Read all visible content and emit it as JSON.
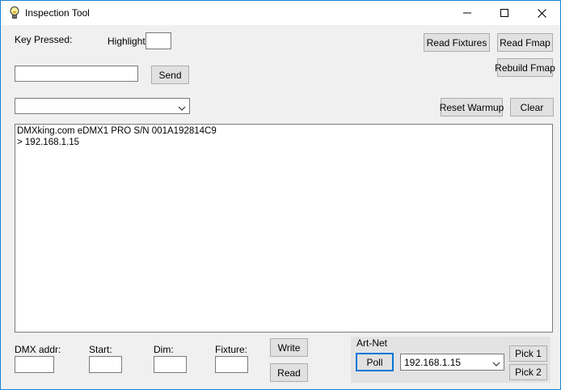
{
  "window": {
    "title": "Inspection Tool",
    "app_icon": "lightbulb-icon",
    "controls": [
      "minimize-icon",
      "maximize-icon",
      "close-icon"
    ]
  },
  "top": {
    "key_pressed_label": "Key Pressed:",
    "highlight_label": "Highlight:",
    "highlight_value": "",
    "command_value": "",
    "send_label": "Send",
    "dropdown_value": "",
    "read_fixtures_label": "Read Fixtures",
    "read_fmap_label": "Read Fmap",
    "rebuild_fmap_label": "Rebuild Fmap",
    "reset_warmup_label": "Reset Warmup",
    "clear_label": "Clear"
  },
  "output": {
    "lines": [
      "DMXking.com eDMX1 PRO S/N 001A192814C9",
      "> 192.168.1.15"
    ]
  },
  "bottom": {
    "dmx_addr_label": "DMX addr:",
    "dmx_addr_value": "",
    "start_label": "Start:",
    "start_value": "",
    "dim_label": "Dim:",
    "dim_value": "",
    "fixture_label": "Fixture:",
    "fixture_value": "",
    "write_label": "Write",
    "read_label": "Read"
  },
  "artnet": {
    "group_label": "Art-Net",
    "poll_label": "Poll",
    "selected_ip": "192.168.1.15",
    "pick1_label": "Pick 1",
    "pick2_label": "Pick 2"
  },
  "colors": {
    "window_border": "#1883d7",
    "focus_border": "#0078d7",
    "button_face": "#e1e1e1",
    "form_background": "#f0f0f0",
    "artnet_group": "#e3e3e3"
  }
}
